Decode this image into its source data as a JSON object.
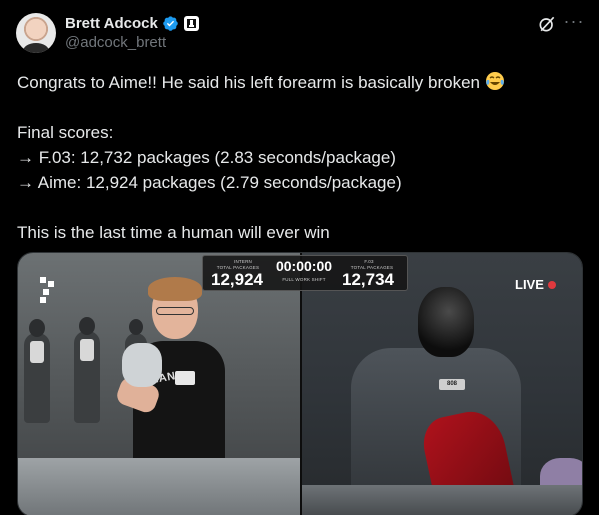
{
  "author": {
    "name": "Brett Adcock",
    "handle": "@adcock_brett"
  },
  "tweet": {
    "line1": "Congrats to Aime!! He said his left forearm is basically broken",
    "line1_emoji": "tears-of-joy-emoji",
    "scores_heading": "Final scores:",
    "score_f03": "→ F.03: 12,732 packages (2.83 seconds/package)",
    "score_aime": "→ Aime: 12,924 packages (2.79 seconds/package)",
    "closing": "This is the last time a human will ever win"
  },
  "media": {
    "scoreboard": {
      "left_label_top": "INTERN",
      "left_label": "TOTAL PACKAGES",
      "left_value": "12,924",
      "timer": "00:00:00",
      "timer_label": "FULL WORK SHIFT",
      "right_label_top": "F.03",
      "right_label": "TOTAL PACKAGES",
      "right_value": "12,734"
    },
    "live_label": "LIVE",
    "shirt_text": "UNAN",
    "robot_badge": "808"
  },
  "colors": {
    "background": "#000000",
    "text": "#e7e9ea",
    "muted": "#71767b",
    "verified_blue": "#1d9bf0",
    "live_red": "#e0393e"
  },
  "icons": [
    "verified-badge-icon",
    "affiliate-badge-icon",
    "grok-icon",
    "more-icon",
    "tears-of-joy-emoji"
  ]
}
